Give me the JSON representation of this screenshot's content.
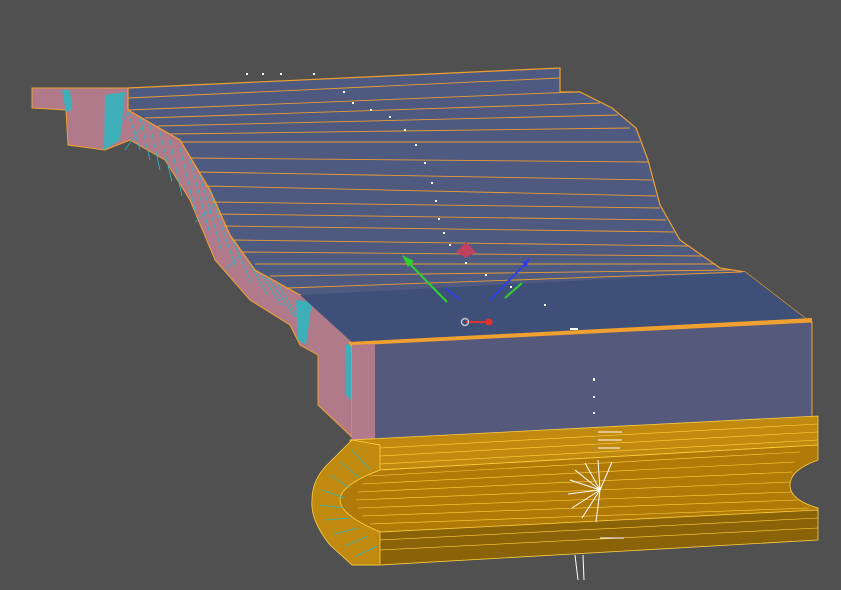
{
  "viewport": {
    "background": "#505050"
  },
  "model": {
    "colors": {
      "top_surface": "#4e5a80",
      "top_surface_dark": "#3e5078",
      "front_face": "#555a7c",
      "side_face": "#b07a8a",
      "bevel_wire": "#2ab8c0",
      "edge_highlight": "#f0a030",
      "bead_fill": "#c08a10",
      "bead_dark": "#8a6208",
      "bead_line": "#ffd040",
      "selected_points": "#ffffff"
    }
  },
  "gizmo": {
    "icons": [
      "move-gizmo-icon",
      "pivot-icon"
    ],
    "colors": {
      "x_axis": "#e03030",
      "y_axis": "#30d030",
      "z_axis": "#3040e0",
      "plane": "#c04060"
    }
  }
}
